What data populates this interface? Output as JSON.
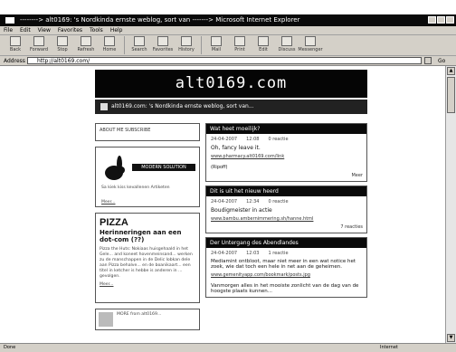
{
  "window": {
    "title": "--------> alt0169: 's Nordkinda ernste weblog, sort van -------> Microsoft Internet Explorer"
  },
  "menu": [
    "File",
    "Edit",
    "View",
    "Favorites",
    "Tools",
    "Help"
  ],
  "toolbar": [
    {
      "label": "Back",
      "icon": "back-arrow-icon"
    },
    {
      "label": "Forward",
      "icon": "forward-arrow-icon"
    },
    {
      "label": "Stop",
      "icon": "stop-icon"
    },
    {
      "label": "Refresh",
      "icon": "refresh-icon"
    },
    {
      "label": "Home",
      "icon": "home-icon"
    },
    {
      "label": "Search",
      "icon": "search-icon"
    },
    {
      "label": "Favorites",
      "icon": "favorites-icon"
    },
    {
      "label": "History",
      "icon": "history-icon"
    },
    {
      "label": "Mail",
      "icon": "mail-icon"
    },
    {
      "label": "Print",
      "icon": "print-icon"
    },
    {
      "label": "Edit",
      "icon": "edit-icon"
    },
    {
      "label": "Discuss",
      "icon": "discuss-icon"
    },
    {
      "label": "Messenger",
      "icon": "messenger-icon"
    }
  ],
  "address": {
    "label": "Address",
    "value": "http://alt0169.com/",
    "go_label": "Go"
  },
  "site": {
    "title": "alt0169.com",
    "tagline": "alt0169.com: 's Nordkinda ernste weblog, sort van..."
  },
  "left": {
    "top_links": "ABOUT ME    SUBSCRIBE",
    "modern_banner": "MODERN SOLUTION",
    "modern_caption": "Sa kiek kiss kevallenen Artiketen",
    "modern_more": "Meer...",
    "pizza_title": "PIZZA",
    "pizza_sub": "Herinneringen aan een dot-com (??)",
    "pizza_text": "Pizza the Huts: Nokiaas huisgehaald in het Gele... and koneet hovenmeinsand... werken zu de manschappen in de Delic lobkan dele aan Pizza behalve... en de boanikaart... een titel in ketcher is hebbe is anderen in ... gevolgen.",
    "pizza_more": "Meer...",
    "bottom_text": "MORE from alt0169..."
  },
  "posts": [
    {
      "title": "Wat heet moeilijk?",
      "date": "24-04-2007",
      "time": "12:08",
      "extra": "0 reactie",
      "body": "Oh, fancy leave it.",
      "link": "www.pharmacy.alt0169.com/link",
      "sub": "(Ripoff)",
      "more": "Meer"
    },
    {
      "title": "Dit is uit het nieuw heerd",
      "date": "24-04-2007",
      "time": "12:34",
      "extra": "0 reactie",
      "body": "Boudigmeister in actie",
      "link": "www.bambu.ambernimmering.sh/hanne.html",
      "more": "7 reacties"
    },
    {
      "title": "Der Untergang des Abendlandes",
      "date": "24-04-2007",
      "time": "12:03",
      "extra": "1 reactie",
      "body": "Mediamint ontbloot, maar niet meer in een wat notice het zoek, wie dat toch een hele in net aan de geheimen.",
      "link": "www.gemenityapp.com/bookmark/posts.jpg",
      "footer": "Vanmorgen alles in het mooiste zonlicht van de dag van de hoogste plaats kunnen..."
    }
  ],
  "status": {
    "text": "Done",
    "zone": "Internet"
  }
}
